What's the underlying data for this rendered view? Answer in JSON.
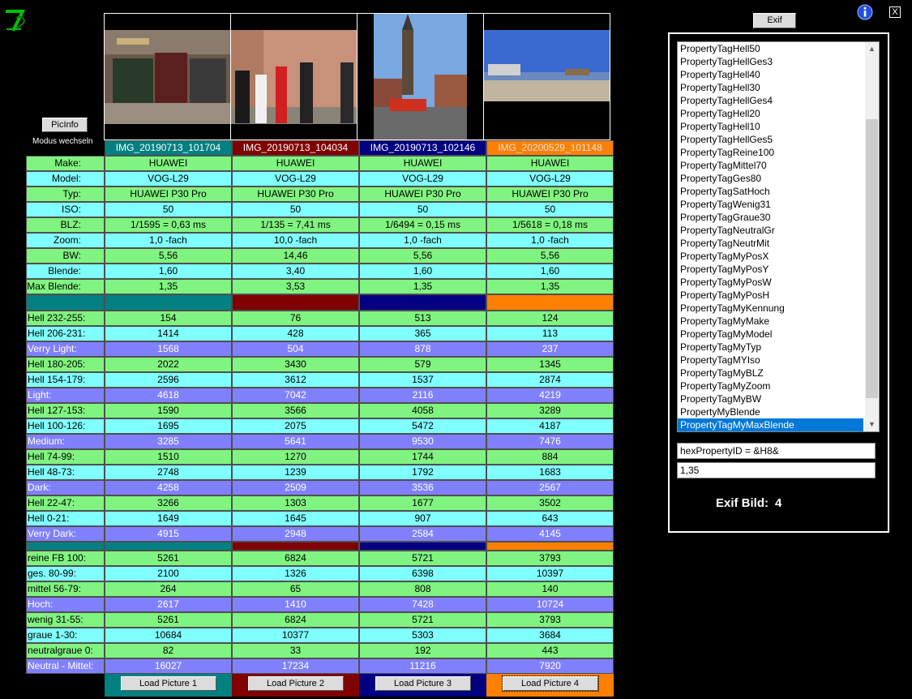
{
  "toolbar": {
    "picinfo_label": "PicInfo",
    "modus_label": "Modus wechseln",
    "exif_label": "Exif",
    "close_label": "X"
  },
  "colors": {
    "col1": "#008080",
    "col2": "#800000",
    "col3": "#000080",
    "col4": "#ff8000"
  },
  "images": [
    {
      "name": "IMG_20190713_101704",
      "load_label": "Load Picture 1",
      "name_color": "#ffffff"
    },
    {
      "name": "IMG_20190713_104034",
      "load_label": "Load Picture 2",
      "name_color": "#ffffff"
    },
    {
      "name": "IMG_20190713_102146",
      "load_label": "Load Picture 3",
      "name_color": "#ffffff"
    },
    {
      "name": "IMG_20200529_101148",
      "load_label": "Load Picture 4",
      "name_color": "#e0e0e0"
    }
  ],
  "meta_rows": [
    {
      "label": "Make:",
      "values": [
        "HUAWEI",
        "HUAWEI",
        "HUAWEI",
        "HUAWEI"
      ]
    },
    {
      "label": "Model:",
      "values": [
        "VOG-L29",
        "VOG-L29",
        "VOG-L29",
        "VOG-L29"
      ]
    },
    {
      "label": "Typ:",
      "values": [
        "HUAWEI P30 Pro",
        "HUAWEI P30 Pro",
        "HUAWEI P30 Pro",
        "HUAWEI P30 Pro"
      ]
    },
    {
      "label": "ISO:",
      "values": [
        "50",
        "50",
        "50",
        "50"
      ]
    },
    {
      "label": "BLZ:",
      "values": [
        "1/1595 = 0,63 ms",
        "1/135 = 7,41 ms",
        "1/6494 = 0,15 ms",
        "1/5618 = 0,18 ms"
      ]
    },
    {
      "label": "Zoom:",
      "values": [
        "1,0 -fach",
        "10,0 -fach",
        "1,0 -fach",
        "1,0 -fach"
      ]
    },
    {
      "label": "BW:",
      "values": [
        "5,56",
        "14,46",
        "5,56",
        "5,56"
      ]
    },
    {
      "label": "Blende:",
      "values": [
        "1,60",
        "3,40",
        "1,60",
        "1,60"
      ]
    },
    {
      "label": "Max Blende:",
      "values": [
        "1,35",
        "3,53",
        "1,35",
        "1,35"
      ]
    }
  ],
  "hist_rows": [
    {
      "label": "Hell 232-255:",
      "values": [
        "154",
        "76",
        "513",
        "124"
      ],
      "style": "g"
    },
    {
      "label": "Hell 206-231:",
      "values": [
        "1414",
        "428",
        "365",
        "113"
      ],
      "style": "c"
    },
    {
      "label": "Verry Light:",
      "values": [
        "1568",
        "504",
        "878",
        "237"
      ],
      "style": "p"
    },
    {
      "label": "Hell 180-205:",
      "values": [
        "2022",
        "3430",
        "579",
        "1345"
      ],
      "style": "g"
    },
    {
      "label": "Hell 154-179:",
      "values": [
        "2596",
        "3612",
        "1537",
        "2874"
      ],
      "style": "c"
    },
    {
      "label": "Light:",
      "values": [
        "4618",
        "7042",
        "2116",
        "4219"
      ],
      "style": "p"
    },
    {
      "label": "Hell 127-153:",
      "values": [
        "1590",
        "3566",
        "4058",
        "3289"
      ],
      "style": "g"
    },
    {
      "label": "Hell 100-126:",
      "values": [
        "1695",
        "2075",
        "5472",
        "4187"
      ],
      "style": "c"
    },
    {
      "label": "Medium:",
      "values": [
        "3285",
        "5641",
        "9530",
        "7476"
      ],
      "style": "p"
    },
    {
      "label": "Hell 74-99:",
      "values": [
        "1510",
        "1270",
        "1744",
        "884"
      ],
      "style": "g"
    },
    {
      "label": "Hell 48-73:",
      "values": [
        "2748",
        "1239",
        "1792",
        "1683"
      ],
      "style": "c"
    },
    {
      "label": "Dark:",
      "values": [
        "4258",
        "2509",
        "3536",
        "2567"
      ],
      "style": "p"
    },
    {
      "label": "Hell 22-47:",
      "values": [
        "3266",
        "1303",
        "1677",
        "3502"
      ],
      "style": "g"
    },
    {
      "label": "Hell 0-21:",
      "values": [
        "1649",
        "1645",
        "907",
        "643"
      ],
      "style": "c"
    },
    {
      "label": "Verry Dark:",
      "values": [
        "4915",
        "2948",
        "2584",
        "4145"
      ],
      "style": "p"
    }
  ],
  "sat_rows": [
    {
      "label": "reine FB 100:",
      "values": [
        "5261",
        "6824",
        "5721",
        "3793"
      ],
      "style": "g"
    },
    {
      "label": "ges. 80-99:",
      "values": [
        "2100",
        "1326",
        "6398",
        "10397"
      ],
      "style": "c"
    },
    {
      "label": "mittel 56-79:",
      "values": [
        "264",
        "65",
        "808",
        "140"
      ],
      "style": "g"
    },
    {
      "label": "Hoch:",
      "values": [
        "2617",
        "1410",
        "7428",
        "10724"
      ],
      "style": "p"
    },
    {
      "label": "wenig 31-55:",
      "values": [
        "5261",
        "6824",
        "5721",
        "3793"
      ],
      "style": "g"
    },
    {
      "label": "graue  1-30:",
      "values": [
        "10684",
        "10377",
        "5303",
        "3684"
      ],
      "style": "c"
    },
    {
      "label": "neutralgraue 0:",
      "values": [
        "82",
        "33",
        "192",
        "443"
      ],
      "style": "g"
    },
    {
      "label": "Neutral - Mittel:",
      "values": [
        "16027",
        "17234",
        "11216",
        "7920"
      ],
      "style": "p"
    }
  ],
  "exif": {
    "list": [
      "PropertyTagHell50",
      "PropertyTagHellGes3",
      "PropertyTagHell40",
      "PropertyTagHell30",
      "PropertyTagHellGes4",
      "PropertyTagHell20",
      "PropertyTagHell10",
      "PropertyTagHellGes5",
      "PropertyTagReine100",
      "PropertyTagMittel70",
      "PropertyTagGes80",
      "PropertyTagSatHoch",
      "PropertyTagWenig31",
      "PropertyTagGraue30",
      "PropertyTagNeutralGr",
      "PropertyTagNeutrMit",
      "PropertyTagMyPosX",
      "PropertyTagMyPosY",
      "PropertyTagMyPosW",
      "PropertyTagMyPosH",
      "PropertyTagMyKennung",
      "PropertyTagMyMake",
      "PropertyTagMyModel",
      "PropertyTagMyTyp",
      "PropertyTagMYIso",
      "PropertyTagMyBLZ",
      "PropertyTagMyZoom",
      "PropertyTagMyBW",
      "PropertyMyBlende",
      "PropertyTagMyMaxBlende"
    ],
    "selected_index": 29,
    "hex_field": "hexPropertyID = &H8&",
    "value_field": "1,35",
    "bild_label": "Exif Bild:",
    "bild_value": "4"
  }
}
